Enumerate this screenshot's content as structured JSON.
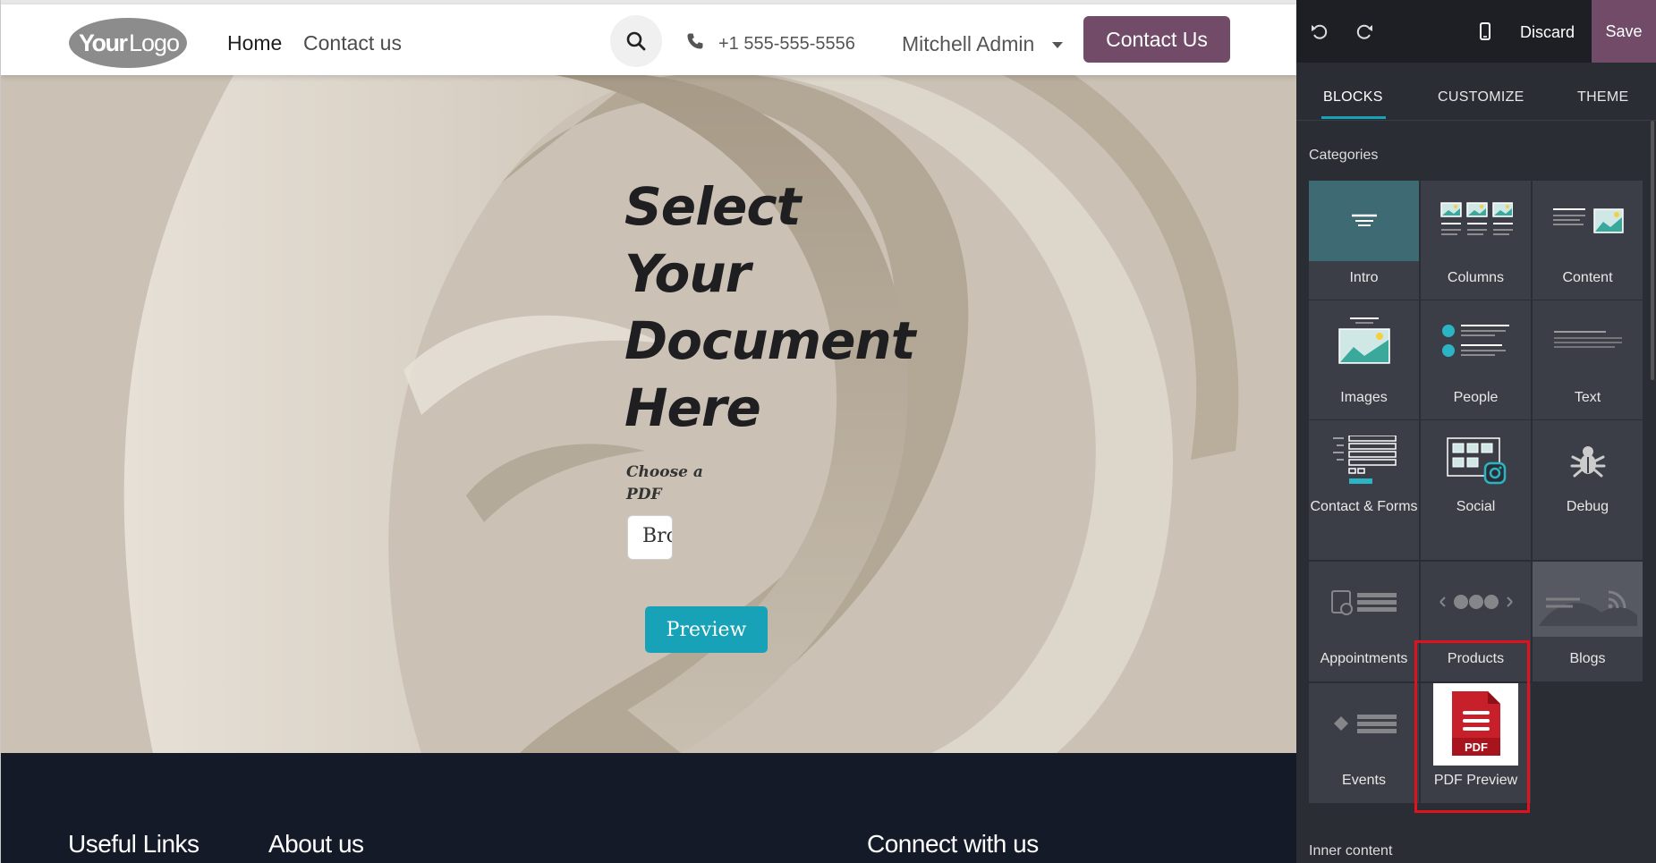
{
  "header": {
    "logo_text": "YourLogo",
    "nav": [
      {
        "label": "Home"
      },
      {
        "label": "Contact us"
      }
    ],
    "phone": "+1 555-555-5556",
    "user": "Mitchell Admin",
    "cta": "Contact Us"
  },
  "hero": {
    "title_lines": [
      "Select",
      "Your",
      "Document",
      "Here"
    ],
    "choose_label": "Choose a PDF",
    "browse_label": "Browse...",
    "preview_label": "Preview"
  },
  "footer": {
    "headings": [
      "Useful Links",
      "About us",
      "Connect with us"
    ]
  },
  "panel": {
    "discard": "Discard",
    "save": "Save",
    "tabs": [
      {
        "label": "BLOCKS",
        "active": true
      },
      {
        "label": "CUSTOMIZE"
      },
      {
        "label": "THEME"
      }
    ],
    "categories_label": "Categories",
    "blocks": [
      {
        "label": "Intro",
        "icon": "intro-icon"
      },
      {
        "label": "Columns",
        "icon": "columns-icon"
      },
      {
        "label": "Content",
        "icon": "content-icon"
      },
      {
        "label": "Images",
        "icon": "images-icon"
      },
      {
        "label": "People",
        "icon": "people-icon"
      },
      {
        "label": "Text",
        "icon": "text-icon"
      },
      {
        "label": "Contact & Forms",
        "icon": "forms-icon"
      },
      {
        "label": "Social",
        "icon": "social-icon"
      },
      {
        "label": "Debug",
        "icon": "bug-icon"
      },
      {
        "label": "Appointments",
        "icon": "appointments-icon"
      },
      {
        "label": "Products",
        "icon": "products-icon"
      },
      {
        "label": "Blogs",
        "icon": "blogs-icon"
      },
      {
        "label": "Events",
        "icon": "events-icon"
      },
      {
        "label": "PDF Preview",
        "icon": "pdf-icon",
        "badge": "PDF"
      }
    ],
    "inner_content_label": "Inner content"
  },
  "colors": {
    "brand": "#714b67",
    "accent": "#17a2b8",
    "highlight": "#e0121e",
    "footer": "#141a28"
  }
}
